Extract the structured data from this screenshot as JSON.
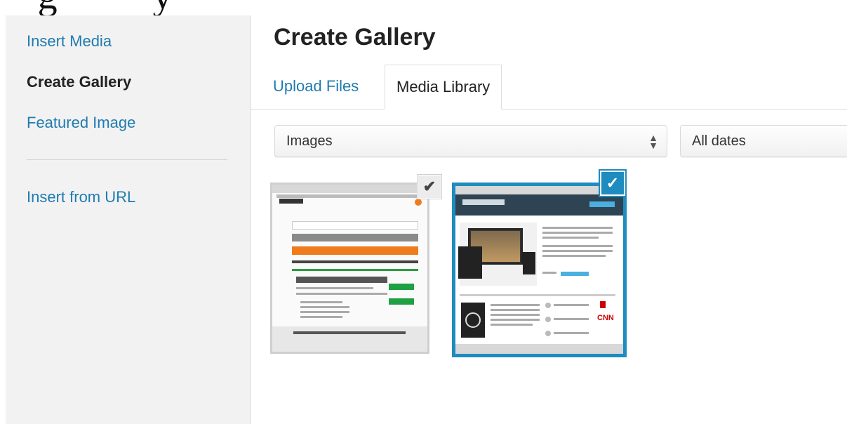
{
  "menu": {
    "items": [
      {
        "label": "Insert Media",
        "active": false
      },
      {
        "label": "Create Gallery",
        "active": true
      },
      {
        "label": "Featured Image",
        "active": false
      },
      {
        "label": "Insert from URL",
        "active": false
      }
    ]
  },
  "frame": {
    "title": "Create Gallery",
    "tabs": [
      {
        "label": "Upload Files",
        "active": false
      },
      {
        "label": "Media Library",
        "active": true
      }
    ]
  },
  "filters": {
    "type_selected": "Images",
    "date_selected": "All dates"
  },
  "attachments": [
    {
      "selected": false,
      "check_glyph": "✔"
    },
    {
      "selected": true,
      "check_glyph": "✓"
    }
  ],
  "thumb2": {
    "logo_text": "CNN"
  },
  "colors": {
    "accent": "#1e8cbe",
    "link": "#1f7bb0",
    "menu_bg": "#f2f2f2"
  }
}
